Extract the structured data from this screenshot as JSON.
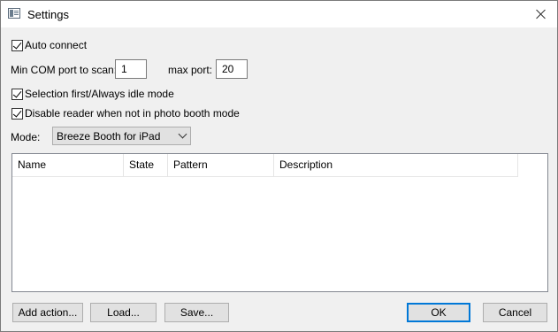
{
  "window": {
    "title": "Settings"
  },
  "options": {
    "auto_connect": {
      "label": "Auto connect",
      "checked": true
    },
    "min_com_label": "Min COM port to scan:",
    "min_com_value": "1",
    "max_port_label": "max port:",
    "max_port_value": "20",
    "selection_first": {
      "label": "Selection first/Always idle mode",
      "checked": true
    },
    "disable_reader": {
      "label": "Disable reader when not in photo booth mode",
      "checked": true
    },
    "mode_label": "Mode:",
    "mode_value": "Breeze Booth for iPad"
  },
  "table": {
    "columns": [
      "Name",
      "State",
      "Pattern",
      "Description"
    ],
    "rows": []
  },
  "buttons": {
    "add_action": "Add action...",
    "load": "Load...",
    "save": "Save...",
    "ok": "OK",
    "cancel": "Cancel"
  },
  "colors": {
    "accent": "#0078d7",
    "window_bg": "#f0f0f0",
    "button_bg": "#e1e1e1"
  },
  "icons": {
    "app": "settings-window-icon",
    "close": "close-icon",
    "dropdown": "chevron-down-icon"
  }
}
